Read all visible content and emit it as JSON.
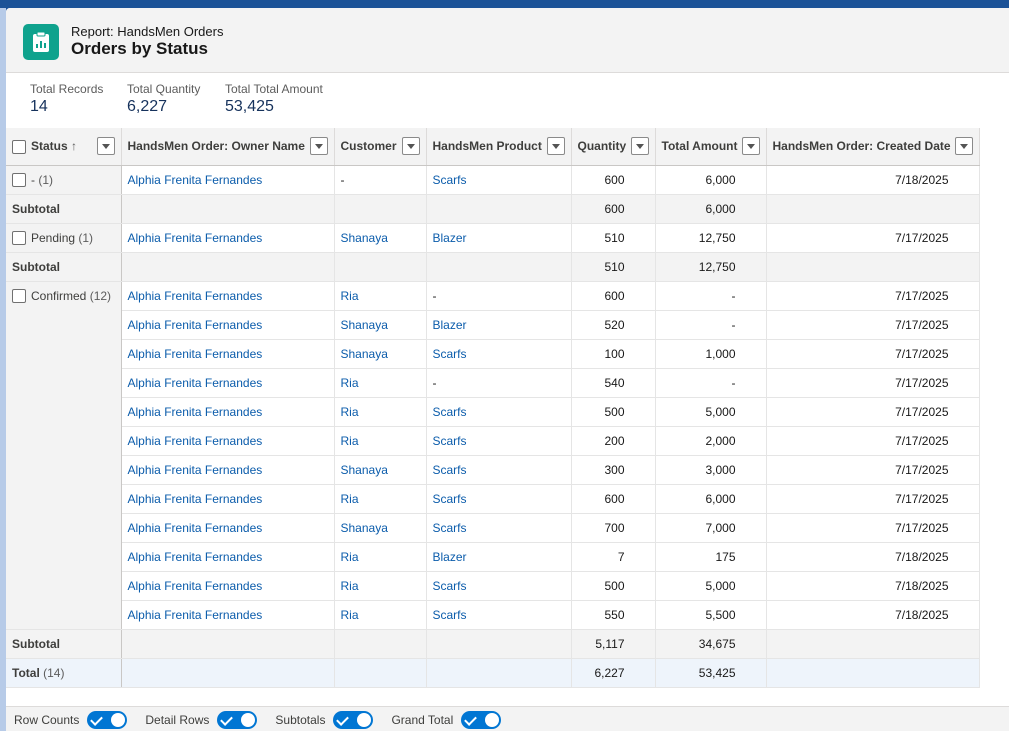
{
  "header": {
    "subtitle": "Report: HandsMen Orders",
    "title": "Orders by Status"
  },
  "summary": [
    {
      "label": "Total Records",
      "value": "14"
    },
    {
      "label": "Total Quantity",
      "value": "6,227"
    },
    {
      "label": "Total Total Amount",
      "value": "53,425"
    }
  ],
  "columns": {
    "status": "Status",
    "sort_indicator": "↑",
    "owner": "HandsMen Order: Owner Name",
    "customer": "Customer",
    "product": "HandsMen Product",
    "quantity": "Quantity",
    "amount": "Total Amount",
    "created": "HandsMen Order: Created Date"
  },
  "groups": [
    {
      "label": "-",
      "count": "(1)",
      "rows": [
        {
          "owner": "Alphia Frenita Fernandes",
          "customer": "-",
          "product": "Scarfs",
          "quantity": "600",
          "amount": "6,000",
          "date": "7/18/2025"
        }
      ],
      "subtotal": {
        "label": "Subtotal",
        "quantity": "600",
        "amount": "6,000"
      }
    },
    {
      "label": "Pending",
      "count": "(1)",
      "rows": [
        {
          "owner": "Alphia Frenita Fernandes",
          "customer": "Shanaya",
          "product": "Blazer",
          "quantity": "510",
          "amount": "12,750",
          "date": "7/17/2025"
        }
      ],
      "subtotal": {
        "label": "Subtotal",
        "quantity": "510",
        "amount": "12,750"
      }
    },
    {
      "label": "Confirmed",
      "count": "(12)",
      "rows": [
        {
          "owner": "Alphia Frenita Fernandes",
          "customer": "Ria",
          "product": "-",
          "quantity": "600",
          "amount": "-",
          "date": "7/17/2025"
        },
        {
          "owner": "Alphia Frenita Fernandes",
          "customer": "Shanaya",
          "product": "Blazer",
          "quantity": "520",
          "amount": "-",
          "date": "7/17/2025"
        },
        {
          "owner": "Alphia Frenita Fernandes",
          "customer": "Shanaya",
          "product": "Scarfs",
          "quantity": "100",
          "amount": "1,000",
          "date": "7/17/2025"
        },
        {
          "owner": "Alphia Frenita Fernandes",
          "customer": "Ria",
          "product": "-",
          "quantity": "540",
          "amount": "-",
          "date": "7/17/2025"
        },
        {
          "owner": "Alphia Frenita Fernandes",
          "customer": "Ria",
          "product": "Scarfs",
          "quantity": "500",
          "amount": "5,000",
          "date": "7/17/2025"
        },
        {
          "owner": "Alphia Frenita Fernandes",
          "customer": "Ria",
          "product": "Scarfs",
          "quantity": "200",
          "amount": "2,000",
          "date": "7/17/2025"
        },
        {
          "owner": "Alphia Frenita Fernandes",
          "customer": "Shanaya",
          "product": "Scarfs",
          "quantity": "300",
          "amount": "3,000",
          "date": "7/17/2025"
        },
        {
          "owner": "Alphia Frenita Fernandes",
          "customer": "Ria",
          "product": "Scarfs",
          "quantity": "600",
          "amount": "6,000",
          "date": "7/17/2025"
        },
        {
          "owner": "Alphia Frenita Fernandes",
          "customer": "Shanaya",
          "product": "Scarfs",
          "quantity": "700",
          "amount": "7,000",
          "date": "7/17/2025"
        },
        {
          "owner": "Alphia Frenita Fernandes",
          "customer": "Ria",
          "product": "Blazer",
          "quantity": "7",
          "amount": "175",
          "date": "7/18/2025"
        },
        {
          "owner": "Alphia Frenita Fernandes",
          "customer": "Ria",
          "product": "Scarfs",
          "quantity": "500",
          "amount": "5,000",
          "date": "7/18/2025"
        },
        {
          "owner": "Alphia Frenita Fernandes",
          "customer": "Ria",
          "product": "Scarfs",
          "quantity": "550",
          "amount": "5,500",
          "date": "7/18/2025"
        }
      ],
      "subtotal": {
        "label": "Subtotal",
        "quantity": "5,117",
        "amount": "34,675"
      }
    }
  ],
  "total": {
    "label": "Total",
    "count": "(14)",
    "quantity": "6,227",
    "amount": "53,425"
  },
  "footer": {
    "toggles": [
      {
        "label": "Row Counts",
        "on": true
      },
      {
        "label": "Detail Rows",
        "on": true
      },
      {
        "label": "Subtotals",
        "on": true
      },
      {
        "label": "Grand Total",
        "on": true
      }
    ]
  },
  "colors": {
    "accent": "#0176d3",
    "link": "#0b5cab",
    "icon_bg": "#0fa28d",
    "background": "#1b5297"
  },
  "icons": {
    "report": "report-clipboard-icon",
    "dropdown": "chevron-down-icon",
    "sort": "arrow-up-icon",
    "toggle_check": "check-icon"
  }
}
